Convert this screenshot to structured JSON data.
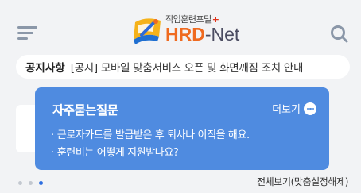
{
  "header": {
    "logo": {
      "subtitle": "직업훈련포털",
      "title_main": "HRD",
      "title_suffix": "-Net"
    },
    "menu_icon": "hamburger-menu-icon",
    "search_icon": "search-icon"
  },
  "notice": {
    "label": "공지사항",
    "text": "[공지] 모바일 맞춤서비스 오픈 및 화면깨짐 조치 안내"
  },
  "faq_card": {
    "title": "자주묻는질문",
    "more_label": "더보기",
    "questions": [
      "근로자카드를 발급받은 후 퇴사나 이직을 해요.",
      "훈련비는 어떻게 지원받나요?"
    ]
  },
  "carousel": {
    "page_count": 3,
    "active_page": 3
  },
  "footer": {
    "link_text": "전체보기(맞춤설정해제)"
  },
  "colors": {
    "brand_orange": "#ef6a1f",
    "card_blue": "#4f8be0",
    "active_dot": "#2d6ee0"
  }
}
